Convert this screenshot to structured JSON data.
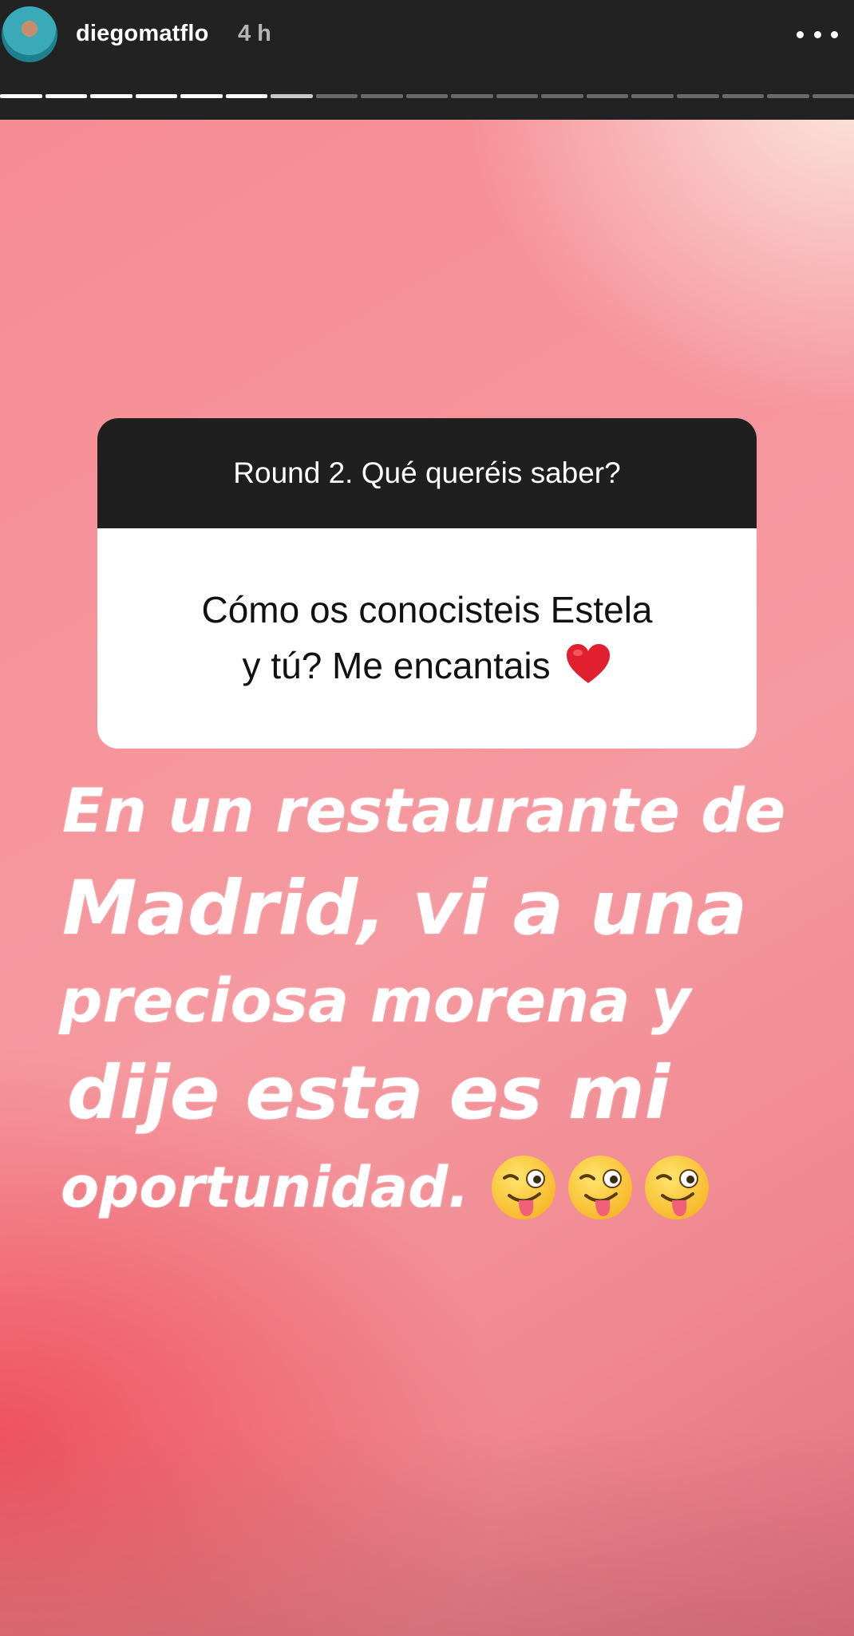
{
  "header": {
    "username": "diegomatflo",
    "timestamp": "4 h",
    "more_icon": "more-horizontal-icon",
    "progress": {
      "total_segments": 19,
      "completed_segments": 6
    }
  },
  "question_sticker": {
    "prompt": "Round 2. Qué queréis saber?",
    "answer_line1": "Cómo os conocisteis Estela",
    "answer_line2": "y tú? Me encantais",
    "emoji": "heart-icon"
  },
  "reply": {
    "line1": "En un restaurante de",
    "line2": "Madrid, vi a una",
    "line3": "preciosa morena y",
    "line4": "dije esta es mi",
    "line5": "oportunidad.",
    "emojis": [
      "winking-face-with-tongue-icon",
      "winking-face-with-tongue-icon",
      "winking-face-with-tongue-icon"
    ]
  },
  "colors": {
    "header_bg": "#222222",
    "card_header_bg": "#1f1f1f",
    "background_pink": "#f6939a",
    "background_red": "#ee4655",
    "heart": "#e0202e"
  }
}
